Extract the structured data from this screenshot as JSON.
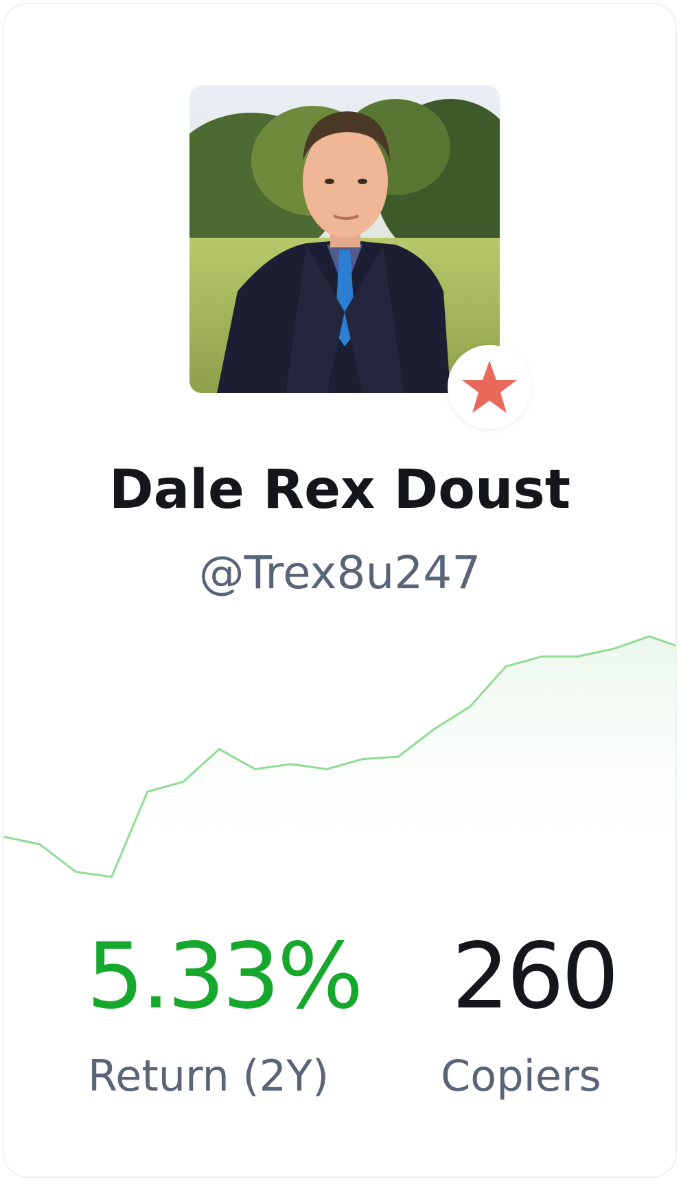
{
  "profile": {
    "name": "Dale Rex Doust",
    "username": "@Trex8u247"
  },
  "stats": {
    "return_value": "5.33%",
    "return_label": "Return (2Y)",
    "copiers_value": "260",
    "copiers_label": "Copiers"
  },
  "colors": {
    "positive": "#15a82c",
    "chart_line": "#8fdc95",
    "badge_star": "#e8695a"
  },
  "chart_data": {
    "type": "area",
    "values": [
      0.2,
      0.17,
      0.06,
      0.04,
      0.38,
      0.42,
      0.55,
      0.47,
      0.49,
      0.47,
      0.51,
      0.52,
      0.63,
      0.72,
      0.88,
      0.92,
      0.92,
      0.95,
      1.0,
      0.95
    ]
  }
}
